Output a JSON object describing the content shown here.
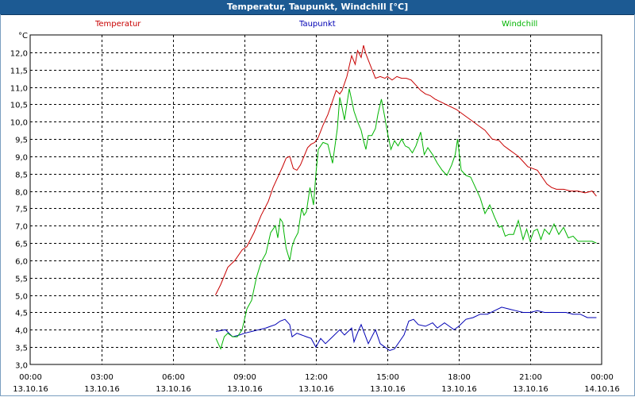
{
  "window": {
    "title": "Temperatur, Taupunkt, Windchill [°C]"
  },
  "chart_data": {
    "type": "line",
    "title": "Temperatur, Taupunkt, Windchill [°C]",
    "ylabel": "°C",
    "ylim": [
      3.0,
      12.5
    ],
    "y_ticks": [
      "3,0",
      "3,5",
      "4,0",
      "4,5",
      "5,0",
      "5,5",
      "6,0",
      "6,5",
      "7,0",
      "7,5",
      "8,0",
      "8,5",
      "9,0",
      "9,5",
      "10,0",
      "10,5",
      "11,0",
      "11,5",
      "12,0"
    ],
    "xlim": [
      0,
      24
    ],
    "x_ticks": [
      {
        "time": "00:00",
        "date": "13.10.16"
      },
      {
        "time": "03:00",
        "date": "13.10.16"
      },
      {
        "time": "06:00",
        "date": "13.10.16"
      },
      {
        "time": "09:00",
        "date": "13.10.16"
      },
      {
        "time": "12:00",
        "date": "13.10.16"
      },
      {
        "time": "15:00",
        "date": "13.10.16"
      },
      {
        "time": "18:00",
        "date": "13.10.16"
      },
      {
        "time": "21:00",
        "date": "13.10.16"
      },
      {
        "time": "00:00",
        "date": "14.10.16"
      }
    ],
    "grid": true,
    "legend": "top",
    "series": [
      {
        "name": "Temperatur",
        "color": "#c80000",
        "x": [
          7.78,
          8.0,
          8.3,
          8.6,
          8.9,
          9.1,
          9.4,
          9.7,
          10.0,
          10.2,
          10.4,
          10.6,
          10.75,
          10.9,
          11.05,
          11.2,
          11.35,
          11.5,
          11.65,
          11.8,
          11.95,
          12.1,
          12.3,
          12.5,
          12.75,
          12.85,
          13.0,
          13.1,
          13.3,
          13.5,
          13.65,
          13.75,
          13.9,
          14.0,
          14.1,
          14.3,
          14.5,
          14.7,
          14.9,
          15.0,
          15.2,
          15.4,
          15.6,
          15.8,
          16.0,
          16.2,
          16.4,
          16.6,
          16.8,
          17.0,
          17.3,
          17.6,
          17.9,
          18.2,
          18.5,
          18.8,
          19.1,
          19.4,
          19.7,
          19.9,
          20.1,
          20.3,
          20.5,
          20.7,
          20.9,
          21.1,
          21.3,
          21.5,
          21.7,
          21.9,
          22.1,
          22.4,
          22.7,
          23.0,
          23.3,
          23.6,
          23.78
        ],
        "values": [
          5.0,
          5.3,
          5.8,
          6.0,
          6.3,
          6.4,
          6.8,
          7.3,
          7.7,
          8.1,
          8.4,
          8.7,
          8.95,
          9.0,
          8.65,
          8.6,
          8.75,
          9.0,
          9.25,
          9.35,
          9.4,
          9.55,
          9.9,
          10.2,
          10.7,
          10.9,
          10.8,
          10.9,
          11.3,
          11.9,
          11.65,
          12.05,
          11.85,
          12.2,
          11.95,
          11.6,
          11.25,
          11.3,
          11.25,
          11.3,
          11.2,
          11.3,
          11.25,
          11.25,
          11.2,
          11.05,
          10.9,
          10.8,
          10.75,
          10.65,
          10.55,
          10.45,
          10.35,
          10.2,
          10.05,
          9.9,
          9.75,
          9.5,
          9.45,
          9.3,
          9.2,
          9.1,
          9.0,
          8.85,
          8.7,
          8.65,
          8.6,
          8.4,
          8.2,
          8.1,
          8.05,
          8.05,
          8.0,
          8.0,
          7.95,
          8.0,
          7.85
        ]
      },
      {
        "name": "Taupunkt",
        "color": "#0000b4",
        "x": [
          7.8,
          8.2,
          8.5,
          8.8,
          9.0,
          9.3,
          9.6,
          9.9,
          10.1,
          10.3,
          10.5,
          10.7,
          10.9,
          11.0,
          11.2,
          11.4,
          11.6,
          11.8,
          12.0,
          12.2,
          12.4,
          12.7,
          13.0,
          13.2,
          13.5,
          13.6,
          13.8,
          13.9,
          14.2,
          14.5,
          14.7,
          14.9,
          15.1,
          15.3,
          15.5,
          15.7,
          15.9,
          16.1,
          16.3,
          16.6,
          16.9,
          17.1,
          17.4,
          17.6,
          17.8,
          18.0,
          18.3,
          18.6,
          18.9,
          19.2,
          19.5,
          19.8,
          20.1,
          20.4,
          20.7,
          21.0,
          21.3,
          21.6,
          21.9,
          22.2,
          22.5,
          22.8,
          23.1,
          23.4,
          23.78
        ],
        "values": [
          3.95,
          4.0,
          3.8,
          3.85,
          3.9,
          3.95,
          4.0,
          4.05,
          4.1,
          4.15,
          4.25,
          4.3,
          4.15,
          3.8,
          3.9,
          3.85,
          3.8,
          3.75,
          3.5,
          3.75,
          3.6,
          3.8,
          4.0,
          3.85,
          4.05,
          3.65,
          4.0,
          4.15,
          3.6,
          4.0,
          3.6,
          3.5,
          3.4,
          3.45,
          3.65,
          3.85,
          4.25,
          4.3,
          4.15,
          4.1,
          4.2,
          4.05,
          4.2,
          4.1,
          4.0,
          4.1,
          4.3,
          4.35,
          4.45,
          4.45,
          4.55,
          4.65,
          4.6,
          4.55,
          4.5,
          4.5,
          4.55,
          4.5,
          4.5,
          4.5,
          4.5,
          4.45,
          4.45,
          4.35,
          4.35
        ]
      },
      {
        "name": "Windchill",
        "color": "#00b400",
        "x": [
          7.8,
          8.0,
          8.15,
          8.3,
          8.5,
          8.7,
          8.9,
          9.0,
          9.1,
          9.3,
          9.5,
          9.7,
          9.9,
          10.0,
          10.1,
          10.3,
          10.4,
          10.5,
          10.6,
          10.75,
          10.9,
          11.0,
          11.1,
          11.25,
          11.4,
          11.5,
          11.6,
          11.75,
          11.9,
          12.0,
          12.1,
          12.3,
          12.5,
          12.7,
          12.9,
          13.0,
          13.1,
          13.2,
          13.4,
          13.6,
          13.75,
          13.9,
          14.0,
          14.1,
          14.2,
          14.35,
          14.5,
          14.6,
          14.75,
          14.9,
          15.0,
          15.15,
          15.3,
          15.45,
          15.6,
          15.75,
          15.9,
          16.05,
          16.2,
          16.4,
          16.55,
          16.7,
          16.9,
          17.1,
          17.3,
          17.5,
          17.7,
          17.85,
          17.95,
          18.1,
          18.3,
          18.5,
          18.7,
          18.9,
          19.1,
          19.3,
          19.5,
          19.7,
          19.8,
          19.95,
          20.1,
          20.3,
          20.5,
          20.7,
          20.85,
          21.0,
          21.15,
          21.3,
          21.45,
          21.6,
          21.8,
          22.0,
          22.2,
          22.4,
          22.6,
          22.8,
          23.0,
          23.2,
          23.4,
          23.6,
          23.78
        ],
        "values": [
          3.75,
          3.45,
          3.8,
          3.9,
          3.8,
          3.8,
          4.0,
          4.3,
          4.6,
          4.85,
          5.5,
          5.95,
          6.2,
          6.5,
          6.8,
          7.0,
          6.65,
          7.2,
          7.1,
          6.35,
          6.0,
          6.4,
          6.6,
          6.8,
          7.5,
          7.3,
          7.4,
          8.1,
          7.6,
          8.5,
          9.2,
          9.4,
          9.35,
          8.8,
          9.8,
          10.7,
          10.4,
          10.05,
          10.95,
          10.3,
          10.0,
          9.75,
          9.45,
          9.2,
          9.6,
          9.6,
          9.8,
          10.2,
          10.65,
          10.1,
          9.7,
          9.2,
          9.45,
          9.3,
          9.5,
          9.3,
          9.25,
          9.1,
          9.3,
          9.7,
          9.05,
          9.25,
          9.05,
          8.8,
          8.6,
          8.45,
          8.75,
          9.05,
          9.5,
          8.6,
          8.45,
          8.4,
          8.1,
          7.8,
          7.35,
          7.6,
          7.25,
          6.95,
          7.0,
          6.7,
          6.75,
          6.75,
          7.15,
          6.6,
          6.9,
          6.55,
          6.85,
          6.9,
          6.6,
          6.9,
          6.75,
          7.05,
          6.75,
          6.95,
          6.65,
          6.7,
          6.55,
          6.55,
          6.55,
          6.55,
          6.5
        ]
      }
    ]
  }
}
